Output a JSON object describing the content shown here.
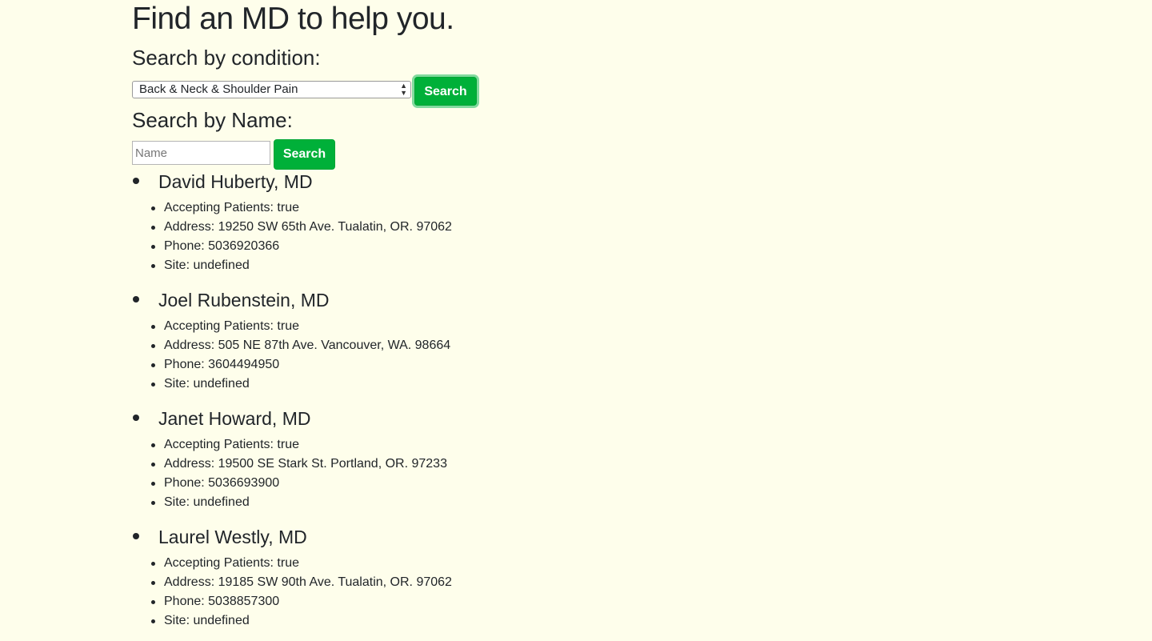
{
  "page": {
    "title": "Find an MD to help you."
  },
  "condition_search": {
    "heading": "Search by condition:",
    "selected": "Back & Neck & Shoulder Pain",
    "button_label": "Search"
  },
  "name_search": {
    "heading": "Search by Name:",
    "placeholder": "Name",
    "value": "",
    "button_label": "Search"
  },
  "doctors": [
    {
      "name": "David Huberty, MD",
      "accepting": "Accepting Patients: true",
      "address": "Address: 19250 SW 65th Ave. Tualatin, OR. 97062",
      "phone": "Phone: 5036920366",
      "site": "Site: undefined"
    },
    {
      "name": "Joel Rubenstein, MD",
      "accepting": "Accepting Patients: true",
      "address": "Address: 505 NE 87th Ave. Vancouver, WA. 98664",
      "phone": "Phone: 3604494950",
      "site": "Site: undefined"
    },
    {
      "name": "Janet Howard, MD",
      "accepting": "Accepting Patients: true",
      "address": "Address: 19500 SE Stark St. Portland, OR. 97233",
      "phone": "Phone: 5036693900",
      "site": "Site: undefined"
    },
    {
      "name": "Laurel Westly, MD",
      "accepting": "Accepting Patients: true",
      "address": "Address: 19185 SW 90th Ave. Tualatin, OR. 97062",
      "phone": "Phone: 5038857300",
      "site": "Site: undefined"
    }
  ],
  "colors": {
    "background": "#fefeeb",
    "button": "#00b039",
    "text": "#212529"
  }
}
